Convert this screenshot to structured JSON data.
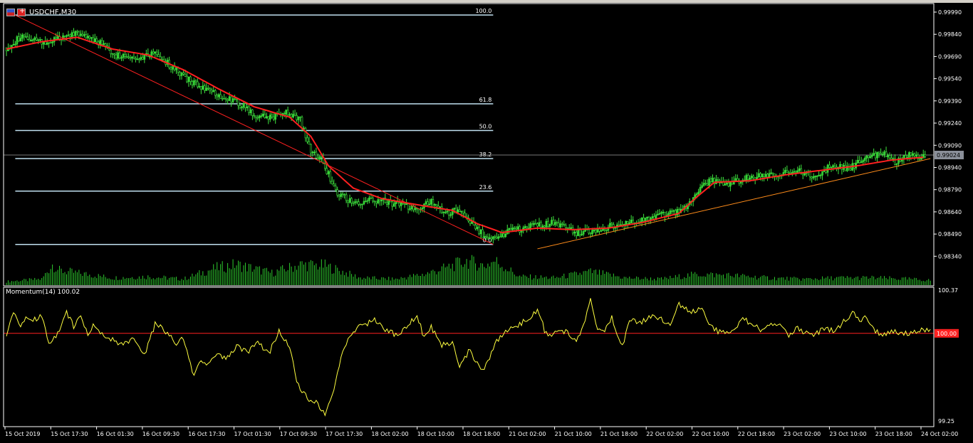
{
  "window": {
    "symbol_label": "USDCHF,M30"
  },
  "indicator": {
    "title": "Momentum(14) 100.02",
    "level_label": "100.00"
  },
  "colors": {
    "bull_candle": "#2ecc2e",
    "bear_candle": "#000000",
    "candle_outline": "#3fe63f",
    "moving_average": "#ff2020",
    "fib_level": "#c0e0f0",
    "trendline_down": "#ff2020",
    "trendline_up": "#ff8c1a",
    "momentum": "#ffff40",
    "momentum_level": "#ff2020",
    "volume": "#2ecc2e",
    "current_price_box": "#8a8f99"
  },
  "chart_data": [
    {
      "type": "candlestick",
      "panel": "price",
      "symbol": "USDCHF",
      "timeframe": "M30",
      "ylim": [
        0.9826,
        0.9999
      ],
      "y_tick_labels": [
        "0.99990",
        "0.99840",
        "0.99690",
        "0.99540",
        "0.99390",
        "0.99240",
        "0.99090",
        "0.98940",
        "0.98790",
        "0.98640",
        "0.98490",
        "0.98340"
      ],
      "current_price": "0.99024",
      "x_tick_labels": [
        "15 Oct 2019",
        "15 Oct 17:30",
        "16 Oct 01:30",
        "16 Oct 09:30",
        "16 Oct 17:30",
        "17 Oct 01:30",
        "17 Oct 09:30",
        "17 Oct 17:30",
        "18 Oct 02:00",
        "18 Oct 10:00",
        "18 Oct 18:00",
        "21 Oct 02:00",
        "21 Oct 10:00",
        "21 Oct 18:00",
        "22 Oct 02:00",
        "22 Oct 10:00",
        "22 Oct 18:00",
        "23 Oct 02:00",
        "23 Oct 10:00",
        "23 Oct 18:00",
        "24 Oct 02:00"
      ],
      "close_path": [
        [
          0,
          0.9975
        ],
        [
          8,
          0.9982
        ],
        [
          14,
          0.998
        ],
        [
          22,
          0.9978
        ],
        [
          30,
          0.9981
        ],
        [
          40,
          0.9985
        ],
        [
          52,
          0.9979
        ],
        [
          62,
          0.997
        ],
        [
          74,
          0.9968
        ],
        [
          84,
          0.9972
        ],
        [
          100,
          0.9955
        ],
        [
          116,
          0.9945
        ],
        [
          128,
          0.994
        ],
        [
          140,
          0.993
        ],
        [
          150,
          0.9928
        ],
        [
          158,
          0.9932
        ],
        [
          166,
          0.9926
        ],
        [
          172,
          0.9905
        ],
        [
          178,
          0.99
        ],
        [
          186,
          0.9878
        ],
        [
          196,
          0.987
        ],
        [
          210,
          0.9872
        ],
        [
          222,
          0.9869
        ],
        [
          234,
          0.9866
        ],
        [
          240,
          0.9872
        ],
        [
          248,
          0.9862
        ],
        [
          256,
          0.9866
        ],
        [
          264,
          0.9855
        ],
        [
          272,
          0.9845
        ],
        [
          282,
          0.985
        ],
        [
          296,
          0.9854
        ],
        [
          310,
          0.9857
        ],
        [
          322,
          0.985
        ],
        [
          336,
          0.9852
        ],
        [
          346,
          0.9856
        ],
        [
          360,
          0.9858
        ],
        [
          372,
          0.9862
        ],
        [
          380,
          0.9864
        ],
        [
          386,
          0.9869
        ],
        [
          392,
          0.988
        ],
        [
          398,
          0.9886
        ],
        [
          406,
          0.9882
        ],
        [
          416,
          0.9886
        ],
        [
          426,
          0.9888
        ],
        [
          436,
          0.989
        ],
        [
          446,
          0.9892
        ],
        [
          456,
          0.9888
        ],
        [
          466,
          0.9895
        ],
        [
          476,
          0.9893
        ],
        [
          484,
          0.9899
        ],
        [
          494,
          0.9904
        ],
        [
          502,
          0.9898
        ],
        [
          510,
          0.9902
        ],
        [
          519,
          0.9901
        ]
      ],
      "moving_average_path": [
        [
          0,
          0.9974
        ],
        [
          20,
          0.9979
        ],
        [
          40,
          0.9982
        ],
        [
          60,
          0.9974
        ],
        [
          80,
          0.997
        ],
        [
          100,
          0.996
        ],
        [
          120,
          0.9947
        ],
        [
          140,
          0.9935
        ],
        [
          160,
          0.9928
        ],
        [
          172,
          0.9915
        ],
        [
          182,
          0.9895
        ],
        [
          196,
          0.988
        ],
        [
          212,
          0.9873
        ],
        [
          236,
          0.9868
        ],
        [
          252,
          0.9865
        ],
        [
          266,
          0.9856
        ],
        [
          280,
          0.985
        ],
        [
          300,
          0.9853
        ],
        [
          320,
          0.9852
        ],
        [
          340,
          0.9853
        ],
        [
          360,
          0.9857
        ],
        [
          380,
          0.9863
        ],
        [
          390,
          0.9874
        ],
        [
          400,
          0.9884
        ],
        [
          420,
          0.9885
        ],
        [
          440,
          0.9889
        ],
        [
          460,
          0.9892
        ],
        [
          480,
          0.9895
        ],
        [
          500,
          0.9899
        ],
        [
          519,
          0.9901
        ]
      ],
      "fibonacci": {
        "levels": [
          {
            "label": "100.0",
            "value": 0.9997
          },
          {
            "label": "61.8",
            "value": 0.9937
          },
          {
            "label": "50.0",
            "value": 0.9919
          },
          {
            "label": "38.2",
            "value": 0.99
          },
          {
            "label": "23.6",
            "value": 0.9878
          },
          {
            "label": "0.0",
            "value": 0.9842
          }
        ],
        "bar_start": 5,
        "bar_end": 275
      },
      "trendlines": [
        {
          "name": "downtrend",
          "from": [
            3,
            0.9998
          ],
          "to": [
            275,
            0.9842
          ]
        },
        {
          "name": "uptrend",
          "from": [
            300,
            0.9839
          ],
          "to": [
            522,
            0.99
          ]
        }
      ],
      "volume_profile": [
        [
          0,
          0.15
        ],
        [
          20,
          0.25
        ],
        [
          26,
          0.85
        ],
        [
          30,
          0.6
        ],
        [
          60,
          0.3
        ],
        [
          80,
          0.35
        ],
        [
          100,
          0.25
        ],
        [
          118,
          0.7
        ],
        [
          130,
          0.85
        ],
        [
          150,
          0.5
        ],
        [
          166,
          0.85
        ],
        [
          180,
          0.8
        ],
        [
          200,
          0.3
        ],
        [
          220,
          0.25
        ],
        [
          236,
          0.45
        ],
        [
          250,
          0.75
        ],
        [
          260,
          1.0
        ],
        [
          270,
          0.8
        ],
        [
          276,
          1.0
        ],
        [
          290,
          0.35
        ],
        [
          310,
          0.3
        ],
        [
          330,
          0.55
        ],
        [
          350,
          0.3
        ],
        [
          370,
          0.25
        ],
        [
          390,
          0.45
        ],
        [
          410,
          0.4
        ],
        [
          430,
          0.3
        ],
        [
          450,
          0.25
        ],
        [
          470,
          0.3
        ],
        [
          490,
          0.3
        ],
        [
          510,
          0.25
        ],
        [
          522,
          0.2
        ]
      ]
    },
    {
      "type": "line",
      "panel": "momentum",
      "name": "Momentum(14)",
      "ylim": [
        99.25,
        100.37
      ],
      "y_tick_labels": [
        "100.37",
        "99.25"
      ],
      "level": 100.0,
      "current_value": 100.02,
      "path": [
        [
          0,
          100.0
        ],
        [
          4,
          100.17
        ],
        [
          8,
          100.08
        ],
        [
          12,
          100.14
        ],
        [
          16,
          100.12
        ],
        [
          20,
          100.15
        ],
        [
          24,
          99.93
        ],
        [
          28,
          99.97
        ],
        [
          34,
          100.18
        ],
        [
          38,
          100.06
        ],
        [
          42,
          100.15
        ],
        [
          46,
          100.0
        ],
        [
          50,
          100.08
        ],
        [
          54,
          100.0
        ],
        [
          60,
          99.95
        ],
        [
          66,
          99.9
        ],
        [
          72,
          99.96
        ],
        [
          78,
          99.82
        ],
        [
          84,
          100.08
        ],
        [
          90,
          100.02
        ],
        [
          96,
          99.9
        ],
        [
          100,
          99.96
        ],
        [
          106,
          99.62
        ],
        [
          110,
          99.78
        ],
        [
          114,
          99.72
        ],
        [
          118,
          99.82
        ],
        [
          124,
          99.78
        ],
        [
          130,
          99.9
        ],
        [
          136,
          99.83
        ],
        [
          142,
          99.92
        ],
        [
          148,
          99.82
        ],
        [
          154,
          100.02
        ],
        [
          160,
          99.9
        ],
        [
          164,
          99.58
        ],
        [
          170,
          99.44
        ],
        [
          176,
          99.4
        ],
        [
          180,
          99.3
        ],
        [
          184,
          99.45
        ],
        [
          190,
          99.85
        ],
        [
          196,
          100.03
        ],
        [
          202,
          100.07
        ],
        [
          208,
          100.12
        ],
        [
          214,
          100.04
        ],
        [
          220,
          99.98
        ],
        [
          228,
          100.09
        ],
        [
          232,
          100.16
        ],
        [
          236,
          99.96
        ],
        [
          240,
          100.05
        ],
        [
          246,
          99.9
        ],
        [
          252,
          99.93
        ],
        [
          256,
          99.73
        ],
        [
          262,
          99.86
        ],
        [
          268,
          99.67
        ],
        [
          272,
          99.75
        ],
        [
          276,
          99.92
        ],
        [
          282,
          100.02
        ],
        [
          288,
          100.05
        ],
        [
          294,
          100.12
        ],
        [
          300,
          100.2
        ],
        [
          304,
          100.03
        ],
        [
          308,
          99.96
        ],
        [
          312,
          100.04
        ],
        [
          318,
          100.0
        ],
        [
          322,
          99.92
        ],
        [
          326,
          100.08
        ],
        [
          330,
          100.28
        ],
        [
          334,
          100.05
        ],
        [
          338,
          100.02
        ],
        [
          342,
          100.14
        ],
        [
          348,
          99.88
        ],
        [
          352,
          100.12
        ],
        [
          358,
          100.08
        ],
        [
          364,
          100.15
        ],
        [
          370,
          100.12
        ],
        [
          376,
          100.08
        ],
        [
          380,
          100.25
        ],
        [
          386,
          100.18
        ],
        [
          392,
          100.22
        ],
        [
          398,
          100.05
        ],
        [
          404,
          100.0
        ],
        [
          410,
          100.03
        ],
        [
          416,
          100.12
        ],
        [
          422,
          100.08
        ],
        [
          426,
          100.02
        ],
        [
          432,
          100.08
        ],
        [
          438,
          100.06
        ],
        [
          442,
          99.96
        ],
        [
          446,
          100.05
        ],
        [
          450,
          100.02
        ],
        [
          456,
          99.98
        ],
        [
          462,
          100.05
        ],
        [
          468,
          100.02
        ],
        [
          474,
          100.12
        ],
        [
          478,
          100.18
        ],
        [
          482,
          100.1
        ],
        [
          486,
          100.15
        ],
        [
          490,
          100.03
        ],
        [
          496,
          99.98
        ],
        [
          502,
          100.02
        ],
        [
          510,
          99.99
        ],
        [
          516,
          100.03
        ],
        [
          522,
          100.02
        ]
      ]
    }
  ]
}
